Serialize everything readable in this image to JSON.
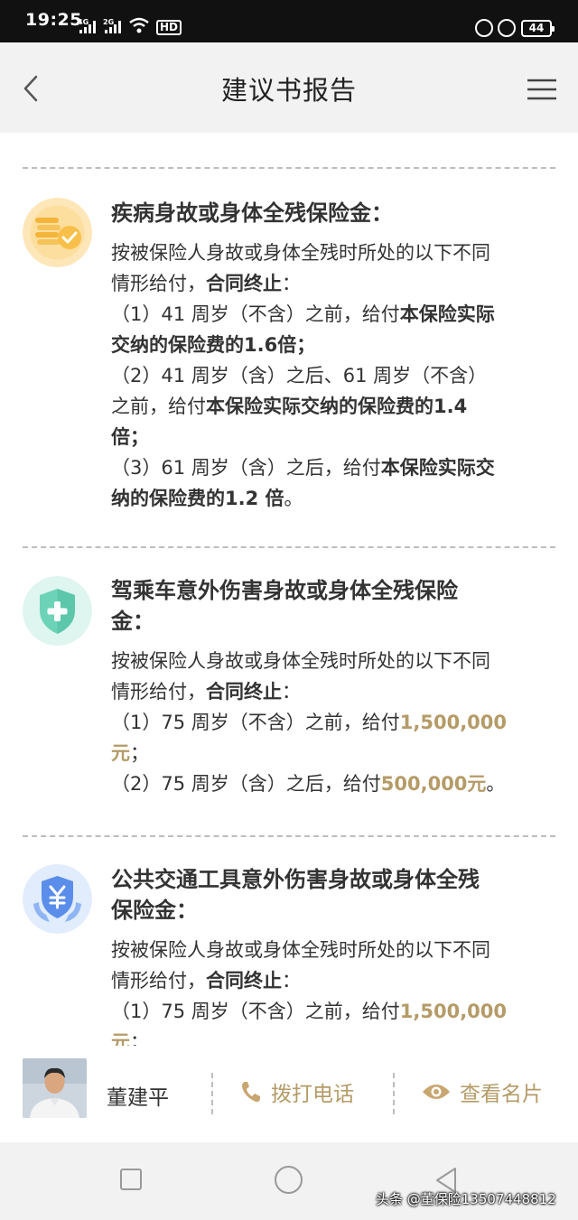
{
  "status_bar": {
    "time": "19:25",
    "signal_1": "4G",
    "signal_2": "2G",
    "hd_label": "HD",
    "battery": "44"
  },
  "header": {
    "title": "建议书报告"
  },
  "benefits": [
    {
      "icon": "coins-check-icon",
      "title_lines": [
        "疾病身故或身体全残保险金："
      ],
      "desc_lines": [
        [
          {
            "t": "按被保险人身故或身体全残时所处的以下不同"
          }
        ],
        [
          {
            "t": "情形给付，"
          },
          {
            "t": "合同终止",
            "s": "bold"
          },
          {
            "t": "："
          }
        ],
        [
          {
            "t": "（1）41 周岁（不含）之前，给付"
          },
          {
            "t": "本保险实际",
            "s": "bold"
          }
        ],
        [
          {
            "t": "交纳的保险费的1.6倍；",
            "s": "bold"
          }
        ],
        [
          {
            "t": "（2）41 周岁（含）之后、61 周岁（不含）"
          }
        ],
        [
          {
            "t": "之前，给付"
          },
          {
            "t": "本保险实际交纳的保险费的1.4",
            "s": "bold"
          }
        ],
        [
          {
            "t": "倍；",
            "s": "bold"
          }
        ],
        [
          {
            "t": "（3）61 周岁（含）之后，给付"
          },
          {
            "t": "本保险实际交",
            "s": "bold"
          }
        ],
        [
          {
            "t": "纳的保险费的1.2 倍",
            "s": "bold"
          },
          {
            "t": "。"
          }
        ]
      ]
    },
    {
      "icon": "shield-plus-icon",
      "title_lines": [
        "驾乘车意外伤害身故或身体全残保险",
        "金："
      ],
      "desc_lines": [
        [
          {
            "t": "按被保险人身故或身体全残时所处的以下不同"
          }
        ],
        [
          {
            "t": "情形给付，"
          },
          {
            "t": "合同终止",
            "s": "bold"
          },
          {
            "t": "："
          }
        ],
        [
          {
            "t": "（1）75 周岁（不含）之前，给付"
          },
          {
            "t": "1,500,000",
            "s": "gold"
          }
        ],
        [
          {
            "t": "元",
            "s": "gold"
          },
          {
            "t": "；"
          }
        ],
        [
          {
            "t": "（2）75 周岁（含）之后，给付"
          },
          {
            "t": "500,000元",
            "s": "gold"
          },
          {
            "t": "。"
          }
        ]
      ]
    },
    {
      "icon": "shield-yuan-icon",
      "title_lines": [
        "公共交通工具意外伤害身故或身体全残",
        "保险金："
      ],
      "desc_lines": [
        [
          {
            "t": "按被保险人身故或身体全残时所处的以下不同"
          }
        ],
        [
          {
            "t": "情形给付，"
          },
          {
            "t": "合同终止",
            "s": "bold"
          },
          {
            "t": "："
          }
        ],
        [
          {
            "t": "（1）75 周岁（不含）之前，给付"
          },
          {
            "t": "1,500,000",
            "s": "gold"
          }
        ],
        [
          {
            "t": "元",
            "s": "gold"
          },
          {
            "t": "；"
          }
        ]
      ]
    }
  ],
  "agent": {
    "name": "董建平",
    "call_label": "拨打电话",
    "card_label": "查看名片"
  },
  "watermark": "头条 @董保险13507448812",
  "colors": {
    "accent_gold": "#b49b67",
    "header_bg": "#f2f2f2",
    "divider": "#bdbdbd"
  }
}
